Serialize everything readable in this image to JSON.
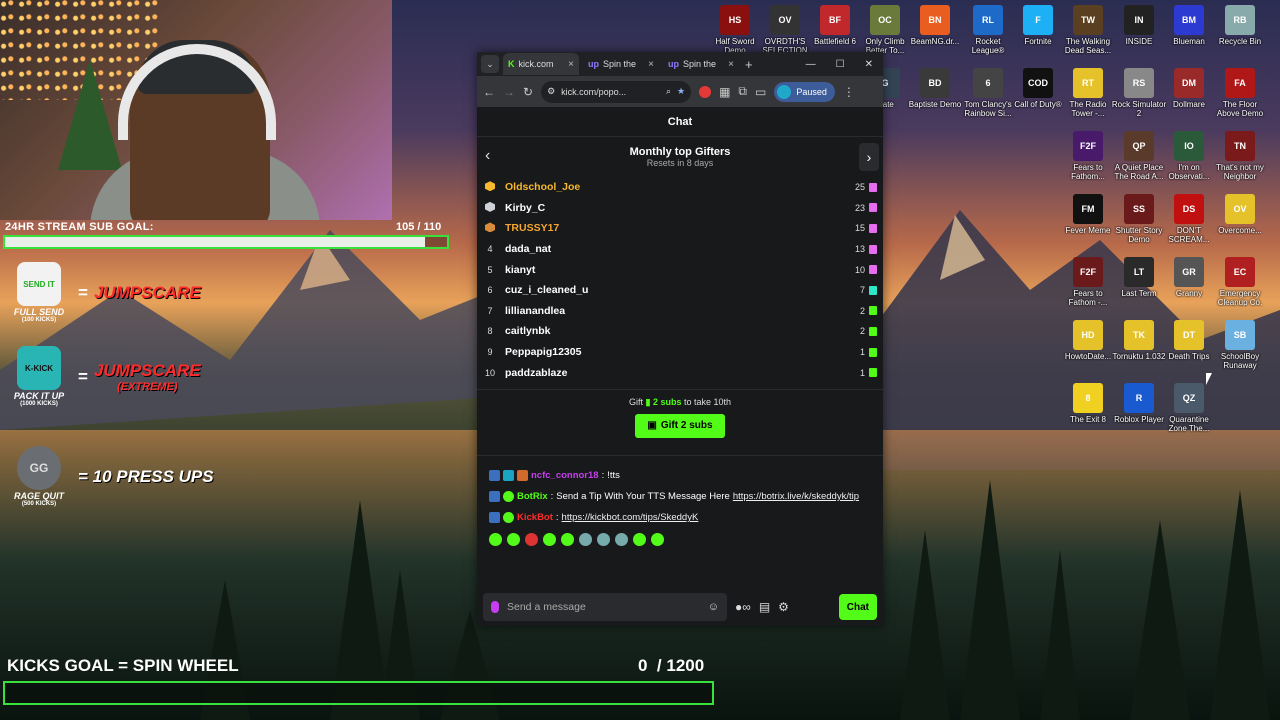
{
  "stream": {
    "sub_goal_label": "24HR STREAM SUB GOAL:",
    "sub_goal_count": "105 / 110",
    "sub_goal_progress": 0.95,
    "rewards": [
      {
        "name": "FULL SEND",
        "sub": "(100 KICKS)",
        "value": "JUMPSCARE",
        "value2": "",
        "icon_text": "SEND IT"
      },
      {
        "name": "PACK IT UP",
        "sub": "(1000 KICKS)",
        "value": "JUMPSCARE",
        "value2": "(EXTREME)",
        "icon_text": "K-KICK"
      },
      {
        "name": "RAGE QUIT",
        "sub": "(500 KICKS)",
        "value": "= 10 PRESS UPS",
        "value2": "",
        "icon_text": "GG"
      }
    ],
    "kicks_goal_label": "KICKS GOAL = SPIN WHEEL",
    "kicks_count": "0",
    "kicks_total": "/ 1200"
  },
  "desktop": {
    "icons": [
      {
        "label": "Half Sword Demo",
        "color": "#8a1010",
        "glyph": "HS"
      },
      {
        "label": "OVRDTH'S SELECTION",
        "color": "#333",
        "glyph": "OV"
      },
      {
        "label": "Battlefield 6",
        "color": "#c0282c",
        "glyph": "BF"
      },
      {
        "label": "Only Climb Better To...",
        "color": "#6a7a3a",
        "glyph": "OC"
      },
      {
        "label": "BeamNG.dr...",
        "color": "#e95d20",
        "glyph": "BN"
      },
      {
        "label": "Rocket League®",
        "color": "#1d6ac9",
        "glyph": "RL"
      },
      {
        "label": "Fortnite",
        "color": "#1db0f5",
        "glyph": "F"
      },
      {
        "label": "The Walking Dead Seas...",
        "color": "#5a4020",
        "glyph": "TW"
      },
      {
        "label": "INSIDE",
        "color": "#222",
        "glyph": "IN"
      },
      {
        "label": "Blueman",
        "color": "#2c3ad1",
        "glyph": "BM"
      },
      {
        "label": "Recycle Bin",
        "color": "#8aa",
        "glyph": "RB"
      },
      {
        "label": "...ate",
        "color": "#345",
        "glyph": "G"
      },
      {
        "label": "Baptiste Demo",
        "color": "#3a3a3a",
        "glyph": "BD"
      },
      {
        "label": "Tom Clancy's Rainbow Si...",
        "color": "#444",
        "glyph": "6"
      },
      {
        "label": "Call of Duty®",
        "color": "#111",
        "glyph": "COD"
      },
      {
        "label": "The Radio Tower -...",
        "color": "#e6c22a",
        "glyph": "RT"
      },
      {
        "label": "Rock Simulator 2",
        "color": "#888",
        "glyph": "RS"
      },
      {
        "label": "Dollmare",
        "color": "#9a2a2a",
        "glyph": "DM"
      },
      {
        "label": "The Floor Above Demo",
        "color": "#b01818",
        "glyph": "FA"
      },
      {
        "label": "Fears to Fathom...",
        "color": "#4a1a6a",
        "glyph": "F2F"
      },
      {
        "label": "A Quiet Place The Road A...",
        "color": "#5a3a2a",
        "glyph": "QP"
      },
      {
        "label": "I'm on Observati...",
        "color": "#2a5a3a",
        "glyph": "IO"
      },
      {
        "label": "That's not my Neighbor",
        "color": "#7a1a1a",
        "glyph": "TN"
      },
      {
        "label": "Fever Meme",
        "color": "#111",
        "glyph": "FM"
      },
      {
        "label": "Shutter Story Demo",
        "color": "#6a1a1a",
        "glyph": "SS"
      },
      {
        "label": "DON'T SCREAM...",
        "color": "#c01010",
        "glyph": "DS"
      },
      {
        "label": "Overcome...",
        "color": "#e6c22a",
        "glyph": "OV"
      },
      {
        "label": "Fears to Fathom -...",
        "color": "#6a1a1a",
        "glyph": "F2F"
      },
      {
        "label": "Last Term",
        "color": "#2a2a2a",
        "glyph": "LT"
      },
      {
        "label": "Granny",
        "color": "#555",
        "glyph": "GR"
      },
      {
        "label": "Emergency Cleanup Co.",
        "color": "#b02020",
        "glyph": "EC"
      },
      {
        "label": "HowtoDate...",
        "color": "#e6c22a",
        "glyph": "HD"
      },
      {
        "label": "Tornuktu 1.032",
        "color": "#e6c22a",
        "glyph": "TK"
      },
      {
        "label": "Death Trips",
        "color": "#e6c22a",
        "glyph": "DT"
      },
      {
        "label": "SchoolBoy Runaway",
        "color": "#6ab0e0",
        "glyph": "SB"
      },
      {
        "label": "The Exit 8",
        "color": "#f0d020",
        "glyph": "8"
      },
      {
        "label": "Roblox Player",
        "color": "#1a5ad0",
        "glyph": "R"
      },
      {
        "label": "Quarantine Zone The...",
        "color": "#4a5a6a",
        "glyph": "QZ"
      }
    ]
  },
  "browser": {
    "tabs": [
      {
        "favicon": "K",
        "title": "kick.com",
        "active": true
      },
      {
        "favicon": "up",
        "title": "Spin the",
        "active": false
      },
      {
        "favicon": "up",
        "title": "Spin the",
        "active": false
      }
    ],
    "url": "kick.com/popo...",
    "profile_label": "Paused",
    "chat_title": "Chat",
    "gifters_title": "Monthly top Gifters",
    "gifters_sub": "Resets in 8 days",
    "gifters": [
      {
        "rank": "",
        "name": "Oldschool_Joe",
        "count": "25",
        "color": "#f5b82e",
        "medal": "#f5b82e",
        "gift": "#e66df0"
      },
      {
        "rank": "",
        "name": "Kirby_C",
        "count": "23",
        "color": "#ffffff",
        "medal": "#cfd2d6",
        "gift": "#e66df0"
      },
      {
        "rank": "",
        "name": "TRUSSY17",
        "count": "15",
        "color": "#f5a62e",
        "medal": "#d98a3a",
        "gift": "#e66df0"
      },
      {
        "rank": "4",
        "name": "dada_nat",
        "count": "13",
        "color": "#ffffff",
        "gift": "#e66df0"
      },
      {
        "rank": "5",
        "name": "kianyt",
        "count": "10",
        "color": "#ffffff",
        "gift": "#e66df0"
      },
      {
        "rank": "6",
        "name": "cuz_i_cleaned_u",
        "count": "7",
        "color": "#ffffff",
        "gift": "#2ee6c8"
      },
      {
        "rank": "7",
        "name": "lillianandlea",
        "count": "2",
        "color": "#ffffff",
        "gift": "#53fc18"
      },
      {
        "rank": "8",
        "name": "caitlynbk",
        "count": "2",
        "color": "#ffffff",
        "gift": "#53fc18"
      },
      {
        "rank": "9",
        "name": "Peppapig12305",
        "count": "1",
        "color": "#ffffff",
        "gift": "#53fc18"
      },
      {
        "rank": "10",
        "name": "paddzablaze",
        "count": "1",
        "color": "#ffffff",
        "gift": "#53fc18"
      }
    ],
    "gift_text_pre": "Gift",
    "gift_text_subs": "2 subs",
    "gift_text_post": "to take 10th",
    "gift_button": "Gift 2 subs",
    "messages": [
      {
        "user": "ncfc_connor18",
        "color": "#c63ef0",
        "text": "!tts",
        "link": ""
      },
      {
        "user": "BotRix",
        "color": "#53fc18",
        "text": "Send a Tip With Your TTS Message Here",
        "link": "https://botrix.live/k/skeddyk/tip"
      },
      {
        "user": "KickBot",
        "color": "#ff2b2b",
        "text": "",
        "link": "https://kickbot.com/tips/SkeddyK"
      }
    ],
    "chat_placeholder": "Send a message",
    "chat_button": "Chat"
  }
}
